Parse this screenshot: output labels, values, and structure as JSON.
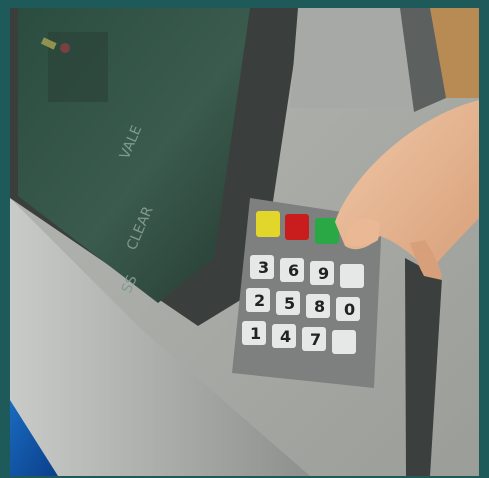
{
  "photo": {
    "screen": {
      "visible_text": [
        "VALE",
        "CLEAR",
        "SS"
      ]
    },
    "keypad": {
      "function_keys": [
        "yellow",
        "red",
        "green"
      ],
      "digits": [
        "1",
        "2",
        "3",
        "4",
        "5",
        "6",
        "7",
        "8",
        "9",
        "0"
      ],
      "colors": {
        "yellow": "#e3d62a",
        "red": "#c91c1c",
        "green": "#2aa845",
        "key": "#e6e8e8",
        "bezel": "#7d807e"
      }
    }
  }
}
